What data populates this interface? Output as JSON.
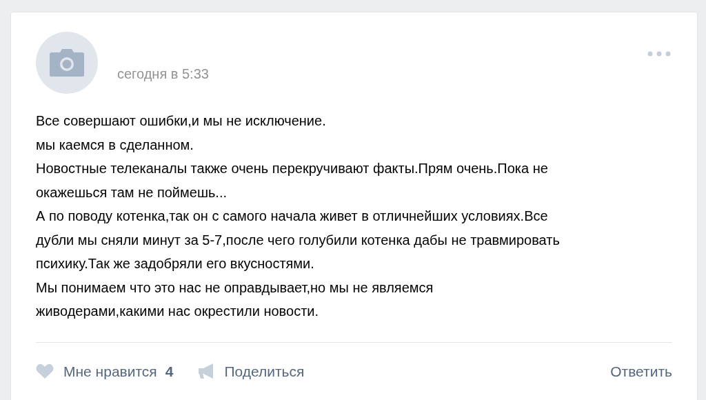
{
  "post": {
    "time": "сегодня в 5:33",
    "paragraphs": [
      {
        "lines": [
          "Все совершают ошибки,и мы не исключение."
        ]
      },
      {
        "lines": [
          "мы каемся в сделанном."
        ]
      },
      {
        "lines": [
          "Новостные телеканалы также очень перекручивают факты.Прям очень.Пока не",
          "окажешься там не поймешь..."
        ]
      },
      {
        "lines": [
          "А по поводу котенка,так он с самого начала живет в отличнейших условиях.Все",
          "дубли мы сняли минут за 5-7,после чего голубили котенка дабы не травмировать",
          "психику.Так же задобряли его вкусностями."
        ]
      },
      {
        "lines": [
          "Мы понимаем что это нас не оправдывает,но мы не являемся",
          "живодерами,какими нас окрестили новости."
        ]
      }
    ],
    "footer": {
      "like": {
        "label": "Мне нравится",
        "count": "4",
        "liked": false
      },
      "share": {
        "label": "Поделиться"
      },
      "reply": {
        "label": "Ответить"
      }
    }
  }
}
